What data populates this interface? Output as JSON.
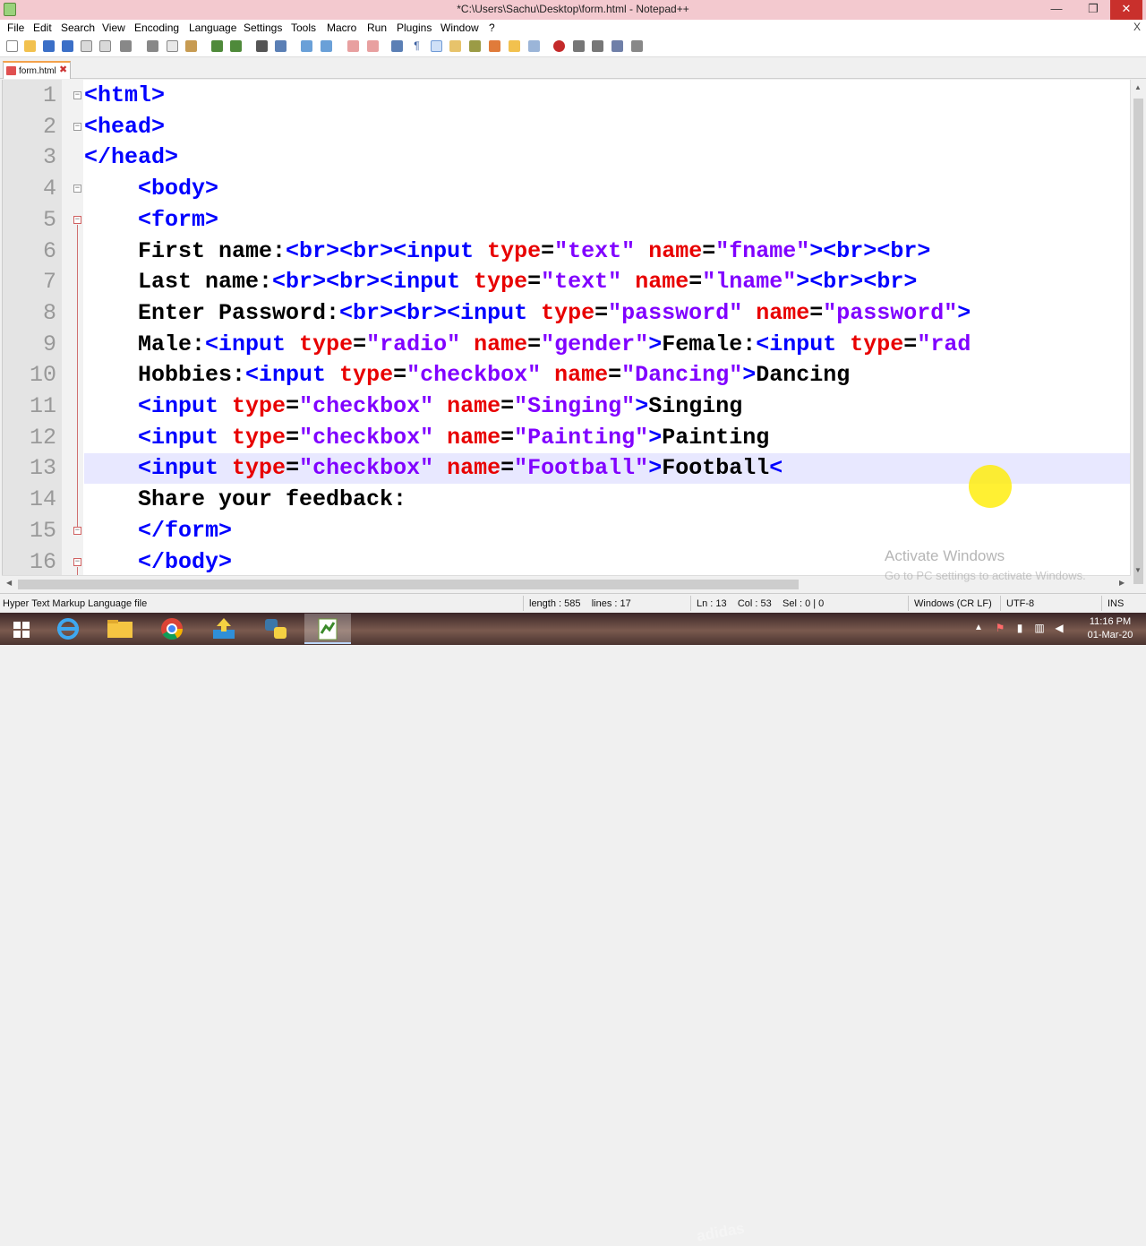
{
  "window": {
    "title": "*C:\\Users\\Sachu\\Desktop\\form.html - Notepad++",
    "minimize_glyph": "—",
    "restore_glyph": "❐",
    "close_glyph": "✕",
    "title_color": "#f3c9cf"
  },
  "menu": {
    "items": [
      "File",
      "Edit",
      "Search",
      "View",
      "Encoding",
      "Language",
      "Settings",
      "Tools",
      "Macro",
      "Run",
      "Plugins",
      "Window",
      "?"
    ],
    "close_doc_glyph": "X"
  },
  "toolbar": {
    "icons": [
      "new-file-icon",
      "open-file-icon",
      "save-icon",
      "save-all-icon",
      "close-icon",
      "close-all-icon",
      "print-icon",
      "cut-icon",
      "copy-icon",
      "paste-icon",
      "undo-icon",
      "redo-icon",
      "find-icon",
      "replace-icon",
      "zoom-in-icon",
      "zoom-out-icon",
      "sync-vertical-icon",
      "sync-horizontal-icon",
      "word-wrap-icon",
      "show-all-chars-icon",
      "indent-guide-icon",
      "user-language-icon",
      "doc-map-icon",
      "function-list-icon",
      "folder-workspace-icon",
      "monitoring-icon",
      "record-macro-icon",
      "stop-macro-icon",
      "play-macro-icon",
      "run-macro-multiple-icon",
      "save-macro-icon"
    ]
  },
  "tabs": [
    {
      "label": "form.html",
      "modified": true,
      "active": true
    }
  ],
  "editor": {
    "current_line": 13,
    "lines": [
      {
        "n": "1",
        "text": "<html>"
      },
      {
        "n": "2",
        "text": "<head>"
      },
      {
        "n": "3",
        "text": "</head>"
      },
      {
        "n": "4",
        "text": "    <body>"
      },
      {
        "n": "5",
        "text": "    <form>"
      },
      {
        "n": "6",
        "text": "    First name:<br><br><input type=\"text\" name=\"fname\"><br><br>"
      },
      {
        "n": "7",
        "text": "    Last name:<br><br><input type=\"text\" name=\"lname\"><br><br>"
      },
      {
        "n": "8",
        "text": "    Enter Password:<br><br><input type=\"password\" name=\"password\">"
      },
      {
        "n": "9",
        "text": "    Male:<input type=\"radio\" name=\"gender\">Female:<input type=\"rad"
      },
      {
        "n": "10",
        "text": "    Hobbies:<input type=\"checkbox\" name=\"Dancing\">Dancing"
      },
      {
        "n": "11",
        "text": "    <input type=\"checkbox\" name=\"Singing\">Singing"
      },
      {
        "n": "12",
        "text": "    <input type=\"checkbox\" name=\"Painting\">Painting"
      },
      {
        "n": "13",
        "text": "    <input type=\"checkbox\" name=\"Football\">Football<"
      },
      {
        "n": "14",
        "text": "    Share your feedback:"
      },
      {
        "n": "15",
        "text": "    </form>"
      },
      {
        "n": "16",
        "text": "    </body>"
      }
    ]
  },
  "watermark": {
    "title": "Activate Windows",
    "subtitle": "Go to PC settings to activate Windows."
  },
  "statusbar": {
    "file_type": "Hyper Text Markup Language file",
    "length_lines": "length : 585    lines : 17",
    "position": "Ln : 13    Col : 53    Sel : 0 | 0",
    "eol": "Windows (CR LF)",
    "encoding": "UTF-8",
    "mode": "INS"
  },
  "taskbar": {
    "apps": [
      "internet-explorer-icon",
      "file-explorer-icon",
      "chrome-icon",
      "app-installer-icon",
      "python-icon",
      "notepad-plus-plus-icon"
    ],
    "time": "11:16 PM",
    "date": "01-Mar-20",
    "background_text": "adidas"
  },
  "syntax_colors": {
    "tag": "#0000ff",
    "attribute": "#e80000",
    "value": "#8000ff",
    "text": "#000000",
    "current_line_bg": "#e8e8ff"
  }
}
